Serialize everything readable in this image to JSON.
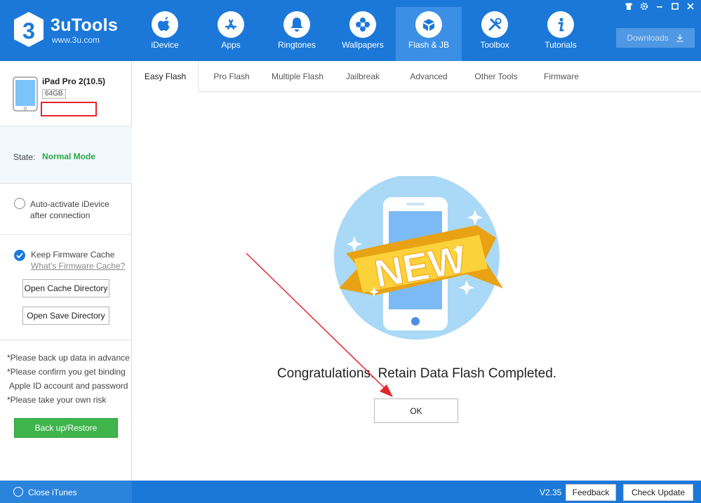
{
  "app": {
    "brand": "3uTools",
    "url": "www.3u.com"
  },
  "nav": [
    {
      "label": "iDevice",
      "icon": "apple-icon"
    },
    {
      "label": "Apps",
      "icon": "app-store-icon"
    },
    {
      "label": "Ringtones",
      "icon": "bell-icon"
    },
    {
      "label": "Wallpapers",
      "icon": "flower-icon"
    },
    {
      "label": "Flash & JB",
      "icon": "box-icon"
    },
    {
      "label": "Toolbox",
      "icon": "tools-icon"
    },
    {
      "label": "Tutorials",
      "icon": "info-icon"
    }
  ],
  "downloads_label": "Downloads",
  "device": {
    "name": "iPad Pro 2(10.5)",
    "capacity": "64GB"
  },
  "state": {
    "label": "State:",
    "value": "Normal Mode"
  },
  "auto_activate": "Auto-activate iDevice after connection",
  "cache": {
    "keep_label": "Keep Firmware Cache",
    "link": "What's Firmware Cache?",
    "open_cache": "Open Cache Directory",
    "open_save": "Open Save Directory"
  },
  "notes": [
    "*Please back up data in advance",
    "*Please confirm you get binding",
    " Apple ID account and password",
    "*Please take your own risk"
  ],
  "backup_button": "Back up/Restore",
  "tabs": [
    "Easy Flash",
    "Pro Flash",
    "Multiple Flash",
    "Jailbreak",
    "Advanced",
    "Other Tools",
    "Firmware"
  ],
  "active_tab": "Easy Flash",
  "badge_text": "NEW",
  "message": "Congratulations. Retain Data Flash Completed.",
  "ok_button": "OK",
  "statusbar": {
    "close_itunes": "Close iTunes",
    "version": "V2.35",
    "feedback": "Feedback",
    "check_update": "Check Update"
  },
  "colors": {
    "brand_blue": "#1b78d9",
    "state_green": "#28a745",
    "backup_green": "#3fb54b",
    "annotation_red": "#e3262c"
  }
}
